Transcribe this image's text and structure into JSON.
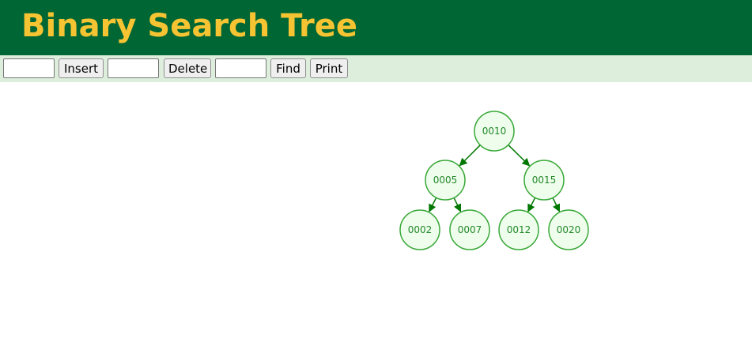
{
  "header": {
    "title": "Binary Search Tree"
  },
  "toolbar": {
    "insert_value": "",
    "insert_label": "Insert",
    "delete_value": "",
    "delete_label": "Delete",
    "find_value": "",
    "find_label": "Find",
    "print_label": "Print"
  },
  "tree": {
    "root": "0010",
    "nodes": [
      {
        "id": "n10",
        "label": "0010"
      },
      {
        "id": "n5",
        "label": "0005"
      },
      {
        "id": "n15",
        "label": "0015"
      },
      {
        "id": "n2",
        "label": "0002"
      },
      {
        "id": "n7",
        "label": "0007"
      },
      {
        "id": "n12",
        "label": "0012"
      },
      {
        "id": "n20",
        "label": "0020"
      }
    ],
    "edges": [
      {
        "from": "n10",
        "to": "n5"
      },
      {
        "from": "n10",
        "to": "n15"
      },
      {
        "from": "n5",
        "to": "n2"
      },
      {
        "from": "n5",
        "to": "n7"
      },
      {
        "from": "n15",
        "to": "n12"
      },
      {
        "from": "n15",
        "to": "n20"
      }
    ]
  },
  "colors": {
    "header_bg": "#006633",
    "title_text": "#f6c432",
    "toolbar_bg": "#deeedd",
    "node_fill": "#effdec",
    "node_stroke": "#38a838",
    "node_text": "#22882a",
    "edge": "#007700"
  }
}
